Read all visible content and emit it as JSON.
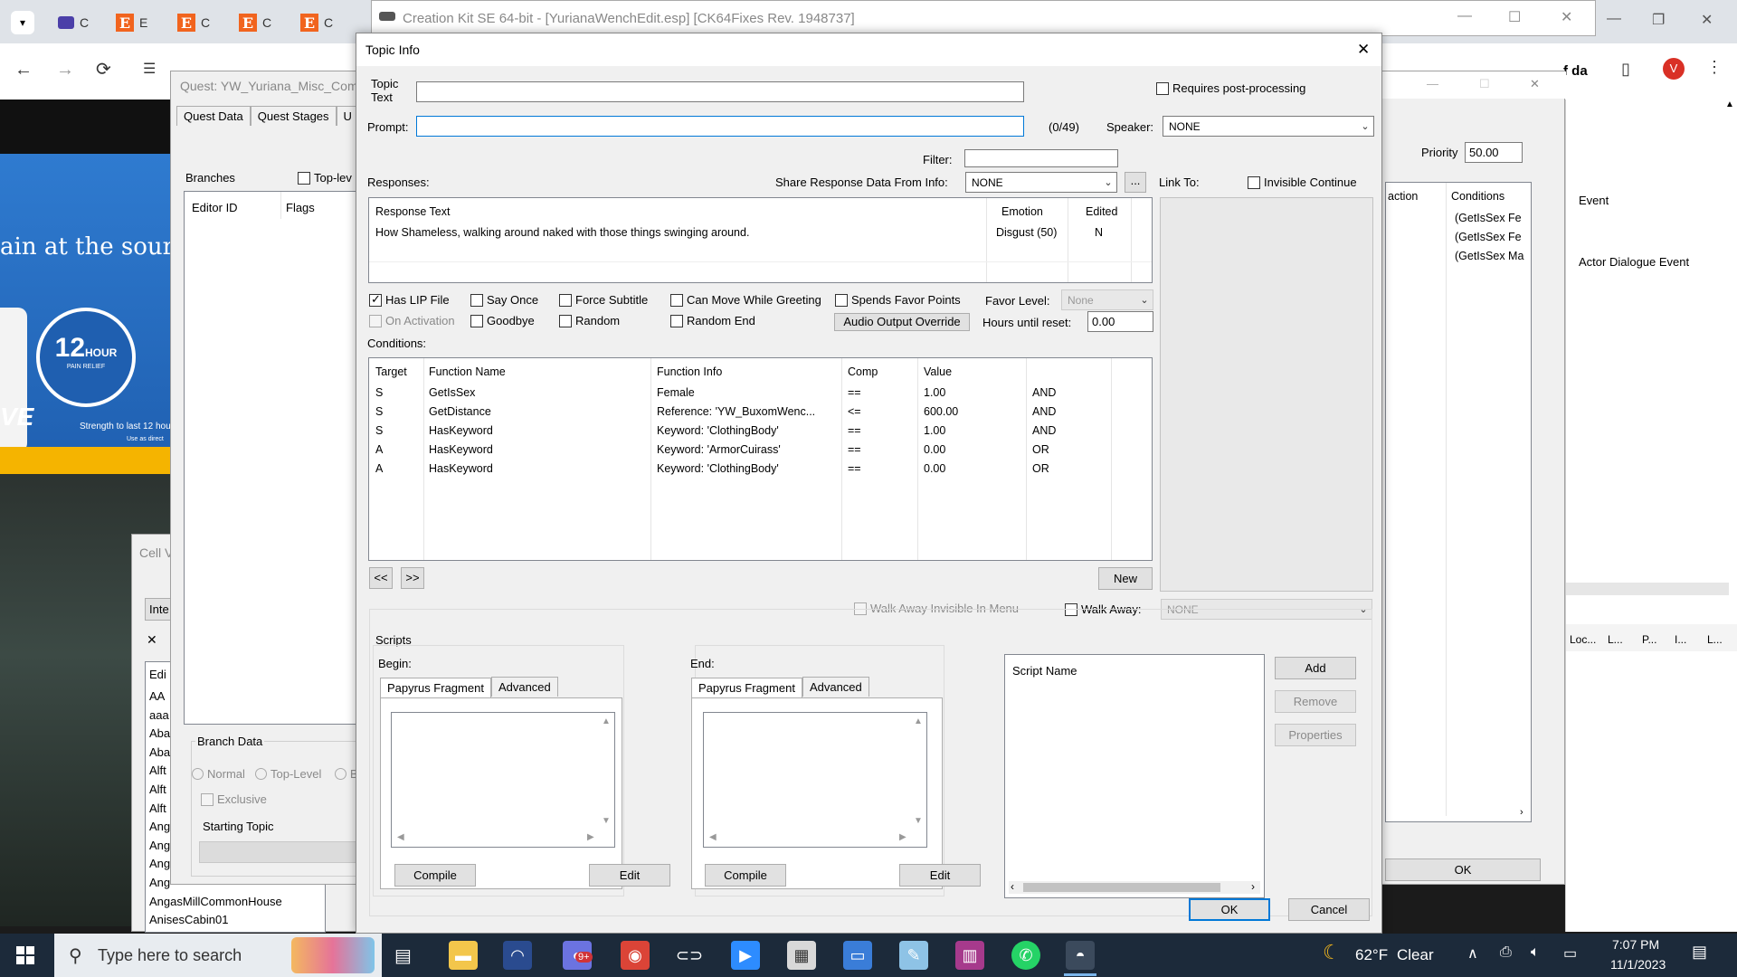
{
  "browser": {
    "tabs": [
      {
        "letter": "C",
        "icon": "ms-icon"
      },
      {
        "letter": "E",
        "icon": "etsy-icon"
      },
      {
        "letter": "C",
        "icon": "etsy-icon"
      },
      {
        "letter": "C",
        "icon": "etsy-icon"
      },
      {
        "letter": "C",
        "icon": "etsy-icon"
      }
    ],
    "ad_text_1": "ain at the source",
    "ad_badge_num": "12",
    "ad_badge_word": "HOUR",
    "ad_badge_sub": "PAIN RELIEF",
    "ad_brand": "VE",
    "ad_tag": "Strength to last 12 hou",
    "ad_tag2": "Use as direct",
    "ad_more": "f da"
  },
  "quest_window": {
    "title": "Quest: YW_Yuriana_Misc_Com",
    "tabs": [
      "Quest Data",
      "Quest Stages",
      "U"
    ],
    "branches_label": "Branches",
    "toplevel_label": "Top-lev",
    "columns": [
      "Editor ID",
      "Flags"
    ],
    "branch_data_label": "Branch Data",
    "radios": [
      "Normal",
      "Top-Level",
      "B"
    ],
    "exclusive_label": "Exclusive",
    "starting_topic_label": "Starting Topic"
  },
  "cell_window": {
    "title": "Cell V",
    "tab": "Inte",
    "col": "Edi",
    "items": [
      "AA",
      "aaa",
      "Aba",
      "Aba",
      "Alft",
      "Alft",
      "Alft",
      "Ang",
      "Ang",
      "Ang",
      "Ang",
      "AngasMillCommonHouse",
      "AnisesCabin01"
    ]
  },
  "ck_main": {
    "title": "Creation Kit SE 64-bit - [YurianaWenchEdit.esp] [CK64Fixes Rev. 1948737]",
    "minimize": "—",
    "maximize": "☐",
    "close": "✕"
  },
  "right_window": {
    "priority_label": "Priority",
    "priority_value": "50.00",
    "col_action": "action",
    "col_conditions": "Conditions",
    "conditions": [
      "(GetIsSex Fe",
      "(GetIsSex Fe",
      "(GetIsSex Ma"
    ],
    "ok": "OK"
  },
  "event_window": {
    "header": "Event",
    "event": "Actor Dialogue Event",
    "cols": [
      "Loc...",
      "L...",
      "P...",
      "I...",
      "L..."
    ]
  },
  "dialog": {
    "title": "Topic Info",
    "topic_text_label": "Topic\nText",
    "topic_text_value": "",
    "requires_post": "Requires post-processing",
    "prompt_label": "Prompt:",
    "prompt_value": "",
    "prompt_count": "(0/49)",
    "speaker_label": "Speaker:",
    "speaker_value": "NONE",
    "filter_label": "Filter:",
    "filter_value": "",
    "responses_label": "Responses:",
    "share_label": "Share Response Data From Info:",
    "share_value": "NONE",
    "ellipsis": "...",
    "link_to_label": "Link To:",
    "invisible_continue": "Invisible Continue",
    "responses": {
      "headers": [
        "Response Text",
        "Emotion",
        "Edited"
      ],
      "rows": [
        {
          "text": "How Shameless, walking around naked with those things swinging around.",
          "emotion": "Disgust (50)",
          "edited": "N"
        }
      ]
    },
    "flags": {
      "has_lip": "Has LIP File",
      "say_once": "Say Once",
      "force_subtitle": "Force Subtitle",
      "can_move": "Can Move While Greeting",
      "spends_favor": "Spends Favor Points",
      "favor_level_label": "Favor Level:",
      "favor_level_value": "None",
      "on_activation": "On Activation",
      "goodbye": "Goodbye",
      "random": "Random",
      "random_end": "Random End",
      "audio_override": "Audio Output Override",
      "hours_label": "Hours until reset:",
      "hours_value": "0.00"
    },
    "conditions_label": "Conditions:",
    "conditions": {
      "headers": [
        "Target",
        "Function Name",
        "Function Info",
        "Comp",
        "Value",
        ""
      ],
      "rows": [
        [
          "S",
          "GetIsSex",
          "Female",
          "==",
          "1.00",
          "AND"
        ],
        [
          "S",
          "GetDistance",
          "Reference: 'YW_BuxomWenc...",
          "<=",
          "600.00",
          "AND"
        ],
        [
          "S",
          "HasKeyword",
          "Keyword: 'ClothingBody'",
          "==",
          "1.00",
          "AND"
        ],
        [
          "A",
          "HasKeyword",
          "Keyword: 'ArmorCuirass'",
          "==",
          "0.00",
          "OR"
        ],
        [
          "A",
          "HasKeyword",
          "Keyword: 'ClothingBody'",
          "==",
          "0.00",
          "OR"
        ]
      ]
    },
    "prev": "<<",
    "next": ">>",
    "new": "New",
    "walk_away_invisible": "Walk Away Invisible In Menu",
    "walk_away": "Walk Away:",
    "walk_away_value": "NONE",
    "scripts_label": "Scripts",
    "begin_label": "Begin:",
    "end_label": "End:",
    "tab_fragment": "Papyrus Fragment",
    "tab_advanced": "Advanced",
    "compile": "Compile",
    "edit": "Edit",
    "script_name_header": "Script Name",
    "add": "Add",
    "remove": "Remove",
    "properties": "Properties",
    "ok": "OK",
    "cancel": "Cancel",
    "close": "✕"
  },
  "taskbar": {
    "search_placeholder": "Type here to search",
    "weather_temp": "62°F",
    "weather_desc": "Clear",
    "time": "7:07 PM",
    "date": "11/1/2023",
    "notif_count": "9+"
  },
  "colors": {
    "taskbar": "#1c2a3a",
    "accent": "#0078d7",
    "dialog_bg": "#f0f0f0"
  }
}
